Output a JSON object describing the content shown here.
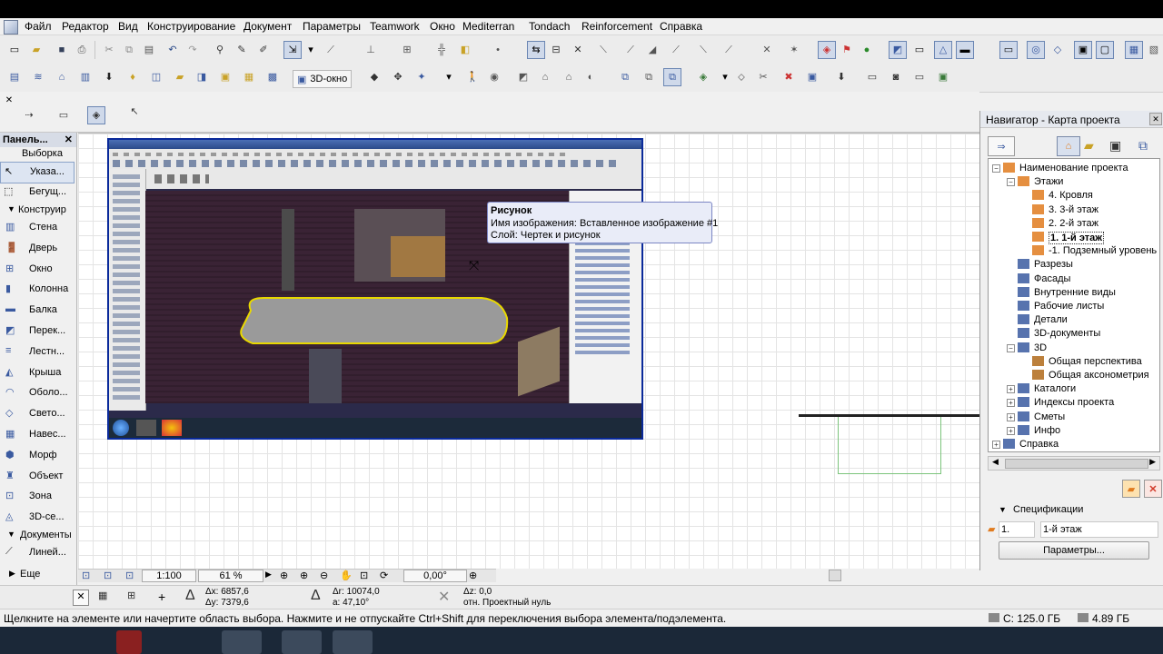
{
  "menu": [
    "Файл",
    "Редактор",
    "Вид",
    "Конструирование",
    "Документ",
    "Параметры",
    "Teamwork",
    "Окно",
    "Mediterran",
    "Tondach",
    "Reinforcement",
    "Справка"
  ],
  "toolbar2": {
    "view3d_label": "3D-окно"
  },
  "left_panel": {
    "title": "Панель...",
    "selection_label": "Выборка",
    "tools_select": [
      {
        "label": "Указа...",
        "icon": "arrow-pointer-icon"
      },
      {
        "label": "Бегущ...",
        "icon": "marquee-icon"
      }
    ],
    "section_construct": "Конструир",
    "tools": [
      {
        "label": "Стена",
        "icon": "wall-icon"
      },
      {
        "label": "Дверь",
        "icon": "door-icon"
      },
      {
        "label": "Окно",
        "icon": "window-icon"
      },
      {
        "label": "Колонна",
        "icon": "column-icon"
      },
      {
        "label": "Балка",
        "icon": "beam-icon"
      },
      {
        "label": "Перек...",
        "icon": "slab-icon"
      },
      {
        "label": "Лестн...",
        "icon": "stair-icon"
      },
      {
        "label": "Крыша",
        "icon": "roof-icon"
      },
      {
        "label": "Оболо...",
        "icon": "shell-icon"
      },
      {
        "label": "Свето...",
        "icon": "skylight-icon"
      },
      {
        "label": "Навес...",
        "icon": "curtain-wall-icon"
      },
      {
        "label": "Морф",
        "icon": "morph-icon"
      },
      {
        "label": "Объект",
        "icon": "object-icon"
      },
      {
        "label": "Зона",
        "icon": "zone-icon"
      },
      {
        "label": "3D-се...",
        "icon": "mesh-icon"
      }
    ],
    "section_documents": "Документы",
    "line_tool": "Линей...",
    "more_label": "Еще"
  },
  "tooltip": {
    "title": "Рисунок",
    "line1": "Имя изображения: Вставленное изображение #1",
    "line2": "Слой: Чертек и рисунок"
  },
  "navigator": {
    "title": "Навигатор - Карта проекта",
    "tree": [
      {
        "label": "Наименование проекта",
        "level": 0,
        "expander": "−",
        "icon": "project-icon"
      },
      {
        "label": "Этажи",
        "level": 1,
        "expander": "−",
        "icon": "stories-icon"
      },
      {
        "label": "4. Кровля",
        "level": 2,
        "expander": "",
        "icon": "story-icon"
      },
      {
        "label": "3. 3-й этаж",
        "level": 2,
        "expander": "",
        "icon": "story-icon"
      },
      {
        "label": "2. 2-й этаж",
        "level": 2,
        "expander": "",
        "icon": "story-icon"
      },
      {
        "label": "1. 1-й этаж",
        "level": 2,
        "expander": "",
        "icon": "story-icon",
        "selected": true
      },
      {
        "label": "-1. Подземный уровень",
        "level": 2,
        "expander": "",
        "icon": "story-icon"
      },
      {
        "label": "Разрезы",
        "level": 1,
        "expander": "",
        "icon": "section-icon"
      },
      {
        "label": "Фасады",
        "level": 1,
        "expander": "",
        "icon": "elevation-icon"
      },
      {
        "label": "Внутренние виды",
        "level": 1,
        "expander": "",
        "icon": "interior-elevation-icon"
      },
      {
        "label": "Рабочие листы",
        "level": 1,
        "expander": "",
        "icon": "worksheet-icon"
      },
      {
        "label": "Детали",
        "level": 1,
        "expander": "",
        "icon": "detail-icon"
      },
      {
        "label": "3D-документы",
        "level": 1,
        "expander": "",
        "icon": "3d-document-icon"
      },
      {
        "label": "3D",
        "level": 1,
        "expander": "−",
        "icon": "3d-icon"
      },
      {
        "label": "Общая перспектива",
        "level": 2,
        "expander": "",
        "icon": "perspective-icon"
      },
      {
        "label": "Общая аксонометрия",
        "level": 2,
        "expander": "",
        "icon": "axonometry-icon"
      },
      {
        "label": "Каталоги",
        "level": 1,
        "expander": "+",
        "icon": "schedule-icon"
      },
      {
        "label": "Индексы проекта",
        "level": 1,
        "expander": "+",
        "icon": "index-icon"
      },
      {
        "label": "Сметы",
        "level": 1,
        "expander": "+",
        "icon": "list-icon"
      },
      {
        "label": "Инфо",
        "level": 1,
        "expander": "+",
        "icon": "info-icon"
      },
      {
        "label": "Справка",
        "level": 0,
        "expander": "+",
        "icon": "help-icon"
      }
    ],
    "specs_label": "Спецификации",
    "spec_story_number": "1.",
    "spec_story_name": "1-й этаж",
    "params_button": "Параметры..."
  },
  "bottom_bar": {
    "scale": "1:100",
    "zoom": "61 %",
    "angle": "0,00°",
    "dx_label": "Δx:",
    "dx_value": "6857,6",
    "dy_label": "Δy:",
    "dy_value": "7379,6",
    "dr_label": "Δr:",
    "dr_value": "10074,0",
    "a_label": "a:",
    "a_value": "47,10°",
    "dz_label": "Δz:",
    "dz_value": "0,0",
    "ref_label": "отн. Проектный нуль"
  },
  "status": {
    "message": "Щелкните на элементе или начертите область выбора. Нажмите и не отпускайте Ctrl+Shift для переключения выбора элемента/подэлемента.",
    "disk_c": "C: 125.0 ГБ",
    "memory": "4.89 ГБ"
  },
  "colors": {
    "accent": "#0a2a9a",
    "selection_yellow": "#e8d800",
    "story_folder": "#e07b1e",
    "close_red": "#d23a2a"
  }
}
